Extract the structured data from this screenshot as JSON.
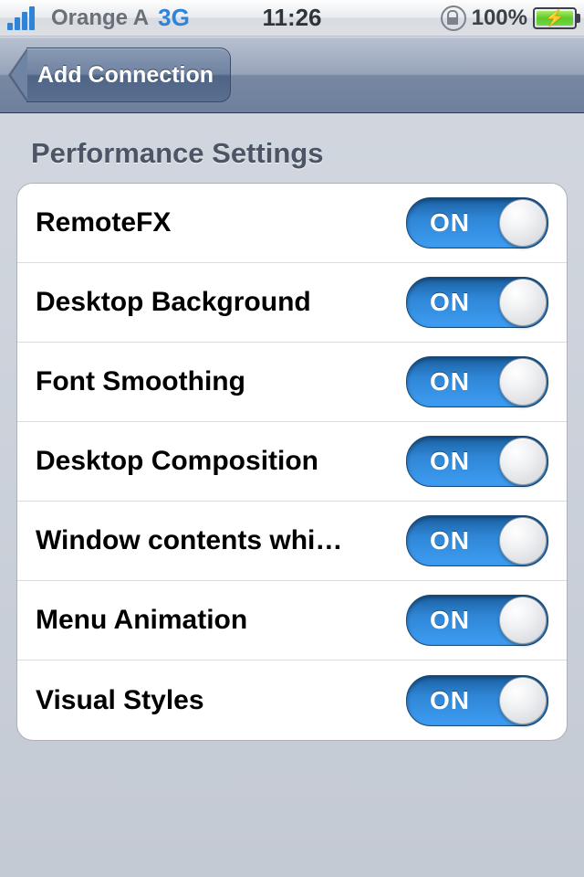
{
  "statusbar": {
    "carrier": "Orange A",
    "network": "3G",
    "time": "11:26",
    "battery_pct": "100%"
  },
  "nav": {
    "back_label": "Add Connection"
  },
  "section": {
    "title": "Performance Settings"
  },
  "rows": [
    {
      "label": "RemoteFX",
      "on_text": "ON"
    },
    {
      "label": "Desktop Background",
      "on_text": "ON"
    },
    {
      "label": "Font Smoothing",
      "on_text": "ON"
    },
    {
      "label": "Desktop Composition",
      "on_text": "ON"
    },
    {
      "label": "Window contents whi…",
      "on_text": "ON"
    },
    {
      "label": "Menu Animation",
      "on_text": "ON"
    },
    {
      "label": "Visual Styles",
      "on_text": "ON"
    }
  ]
}
